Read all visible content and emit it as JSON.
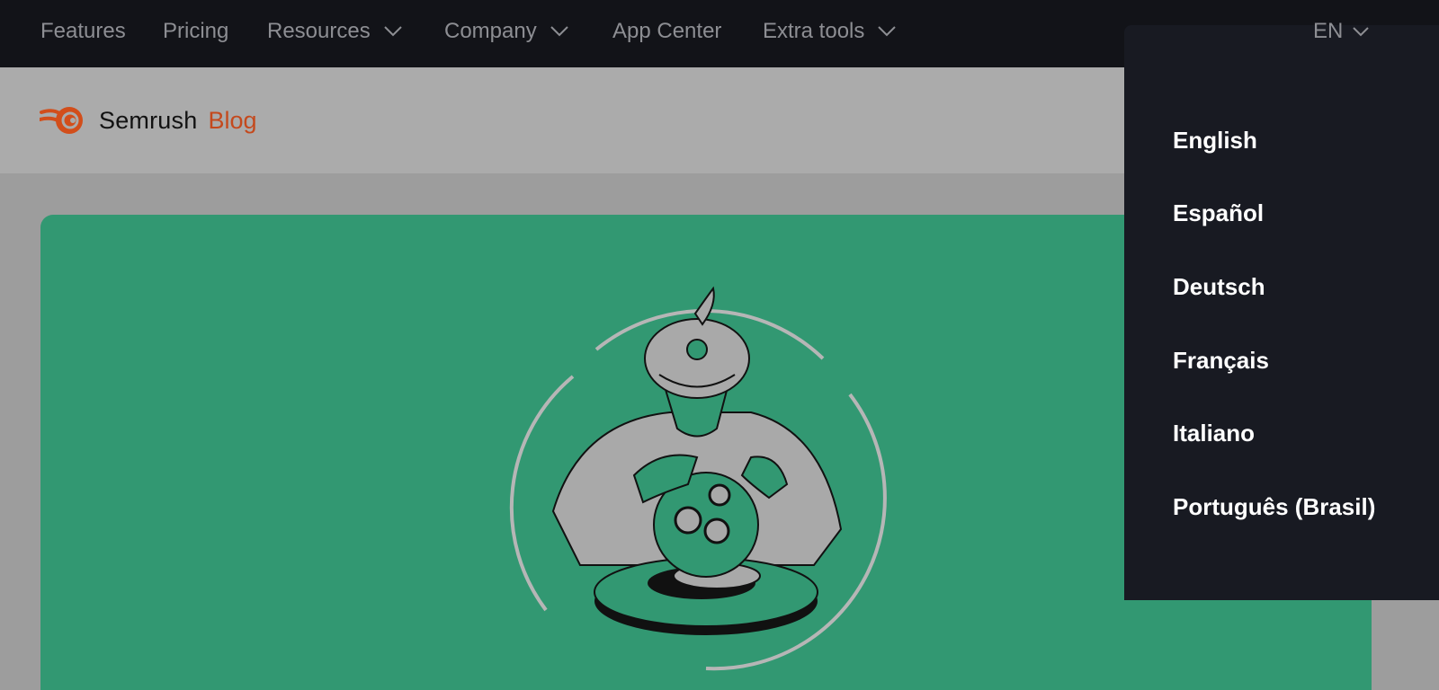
{
  "nav": {
    "items": [
      {
        "label": "Features",
        "has_dropdown": false
      },
      {
        "label": "Pricing",
        "has_dropdown": false
      },
      {
        "label": "Resources",
        "has_dropdown": true
      },
      {
        "label": "Company",
        "has_dropdown": true
      },
      {
        "label": "App Center",
        "has_dropdown": false
      },
      {
        "label": "Extra tools",
        "has_dropdown": true
      }
    ],
    "language_toggle": {
      "label": "EN",
      "expanded": true
    }
  },
  "header": {
    "logo_brand": "Semrush",
    "logo_section": "Blog",
    "logo_accent_color": "#e0531d",
    "logo_section_color": "#c4491d"
  },
  "hero": {
    "background_color": "#329872",
    "illustration": "fortune-teller-with-crystal-ball"
  },
  "language_menu": {
    "options": [
      "English",
      "Español",
      "Deutsch",
      "Français",
      "Italiano",
      "Português (Brasil)"
    ]
  },
  "theme": {
    "nav_background": "#121318",
    "dropdown_background": "#181a22",
    "overlay_color": "#9d9d9d"
  }
}
